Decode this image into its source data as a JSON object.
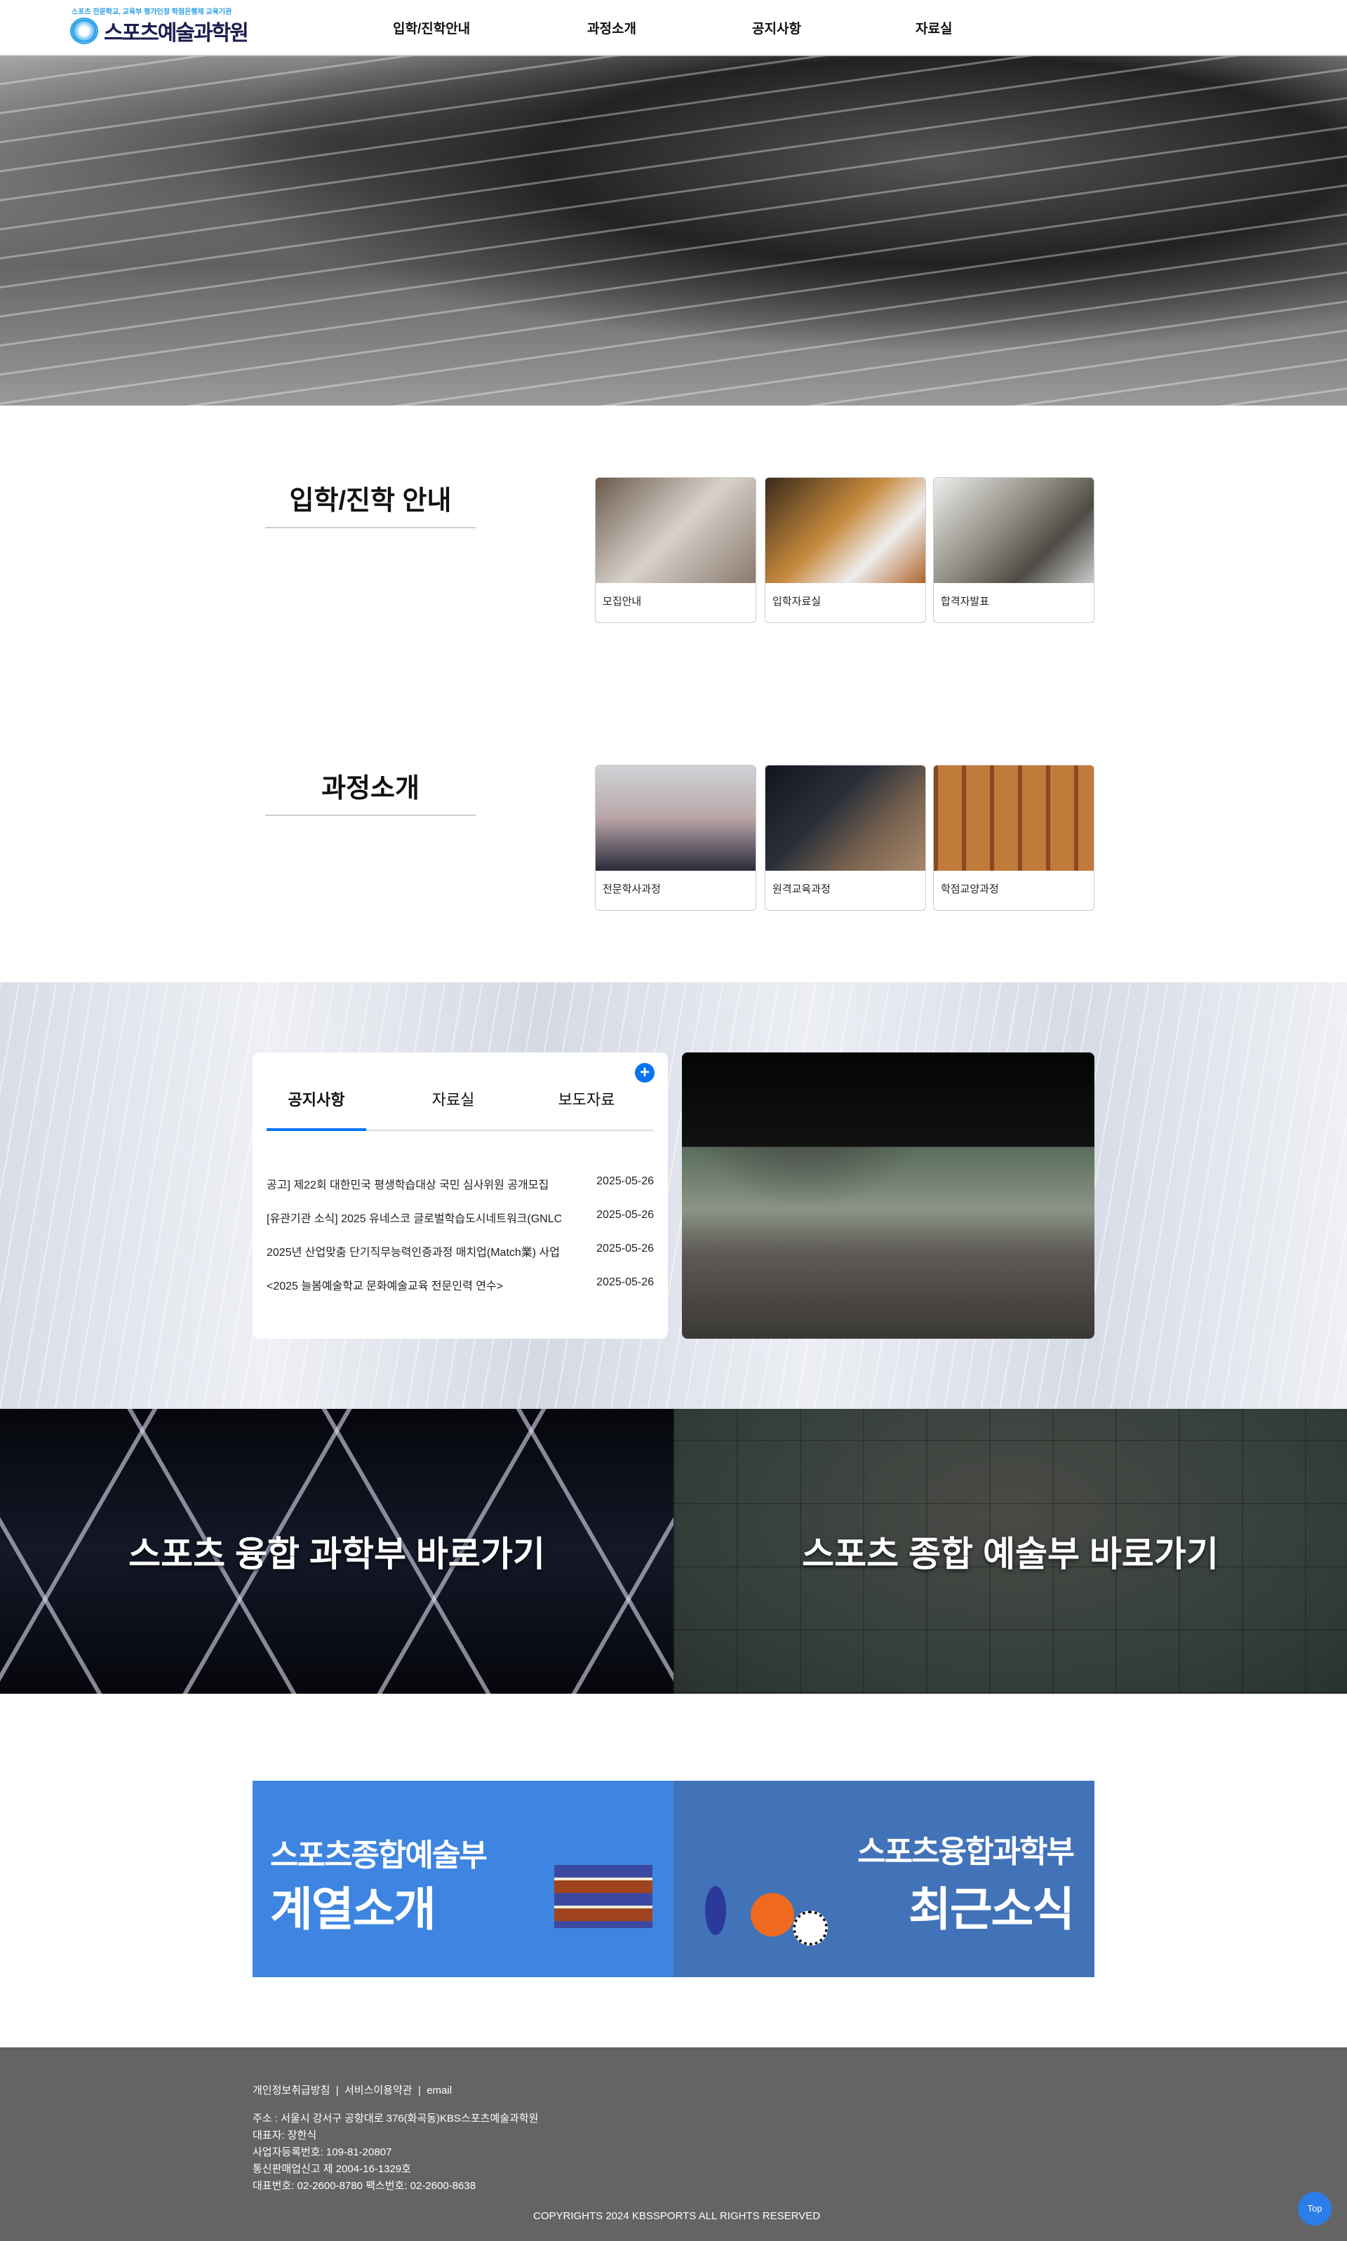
{
  "header": {
    "logo_sub": "스포츠 전문학교, 교육부 평가인정 학점은행제 교육기관",
    "logo_name": "스포츠예술과학원",
    "nav": [
      "입학/진학안내",
      "과정소개",
      "공지사항",
      "자료실"
    ]
  },
  "admission": {
    "title": "입학/진학 안내",
    "cards": [
      "모집안내",
      "입학자료실",
      "합격자발표"
    ]
  },
  "courses": {
    "title": "과정소개",
    "cards": [
      "전문학사과정",
      "원격교육과정",
      "학점교양과정"
    ]
  },
  "notice": {
    "tabs": [
      "공지사항",
      "자료실",
      "보도자료"
    ],
    "more": "+",
    "items": [
      {
        "title": "공고] 제22회 대한민국 평생학습대상 국민 심사위원 공개모집",
        "date": "2025-05-26"
      },
      {
        "title": "[유관기관 소식] 2025 유네스코 글로벌학습도시네트워크(GNLC)..",
        "date": "2025-05-26"
      },
      {
        "title": "2025년 산업맞춤 단기직무능력인증과정 매치업(Match業) 사업 ..",
        "date": "2025-05-26"
      },
      {
        "title": "<2025 늘봄예술학교 문화예술교육 전문인력 연수>",
        "date": "2025-05-26"
      }
    ]
  },
  "shortcuts": {
    "left": "스포츠 융합 과학부 바로가기",
    "right": "스포츠 종합 예술부 바로가기"
  },
  "promos": {
    "left": {
      "line1": "스포츠종합예술부",
      "line2": "계열소개"
    },
    "right": {
      "line1": "스포츠융합과학부",
      "line2": "최근소식"
    }
  },
  "footer": {
    "links": [
      "개인정보취급방침",
      "서비스이용약관",
      "email"
    ],
    "sep": "|",
    "address": "주소 : 서울시 강서구 공항대로 376(화곡동)KBS스포츠예술과학원",
    "ceo": "대표자: 장한식",
    "biz": "사업자등록번호: 109-81-20807",
    "mail_order": "통신판매업신고 제 2004-16-1329호",
    "phone": "대표번호: 02-2600-8780 팩스번호: 02-2600-8638",
    "copyright": "COPYRIGHTS 2024 KBSSPORTS ALL RIGHTS RESERVED"
  },
  "top_button": "Top"
}
